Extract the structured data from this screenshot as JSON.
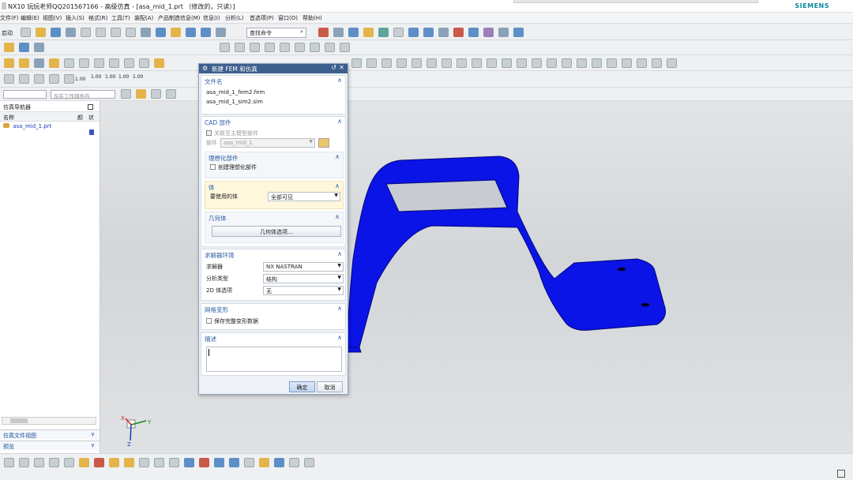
{
  "window": {
    "title": "NX10 玩玩老师QQ201567166 - 高级仿真 - [asa_mid_1.prt （修改的，只读）]",
    "brand": "SIEMENS"
  },
  "menubar": {
    "items": [
      "文件(F)",
      "编辑(E)",
      "视图(V)",
      "插入(S)",
      "格式(R)",
      "工具(T)",
      "装配(A)",
      "产品制造信息(M)",
      "信息(I)",
      "分析(L)",
      "首选项(P)",
      "窗口(O)",
      "帮助(H)"
    ]
  },
  "toolbar": {
    "start_label": "启动",
    "search_placeholder": "查找命令",
    "filter_value": "仅在工作部件内"
  },
  "navigator": {
    "title": "仿真导航器",
    "col_name": "名称",
    "col_2": "颜",
    "col_3": "状",
    "row": "asa_mid_1.prt",
    "footer_1": "仿真文件视图",
    "footer_2": "预览"
  },
  "dialog": {
    "title": "新建 FEM 和仿真",
    "file_section": "文件名",
    "fem_file": "asa_mid_1_fem2.fem",
    "sim_file": "asa_mid_1_sim2.sim",
    "cad_section": "CAD 部件",
    "assoc_label": "关联至主模型部件",
    "part_label": "部件",
    "part_value": "asa_mid_1",
    "ideal_section": "理想化部件",
    "create_ideal": "创建理想化部件",
    "body_section": "体",
    "bodies_label": "要使用的体",
    "bodies_value": "全部可见",
    "geom_section": "几何体",
    "geom_button": "几何体选项...",
    "solver_section": "求解器环境",
    "solver_label": "求解器",
    "solver_value": "NX NASTRAN",
    "analysis_label": "分析类型",
    "analysis_value": "结构",
    "body2d_label": "2D 体选项",
    "body2d_value": "无",
    "morph_section": "网格变形",
    "morph_label": "保存完整变形数据",
    "desc_section": "描述",
    "ok": "确定",
    "cancel": "取消"
  },
  "viewport": {
    "axis_x": "X",
    "axis_y": "Y",
    "axis_z": "Z"
  },
  "toolbar_misc": {
    "v1": "1.00",
    "v2": "1.00",
    "v3": "1.00",
    "v4": "1.00",
    "v5": "1.00"
  }
}
